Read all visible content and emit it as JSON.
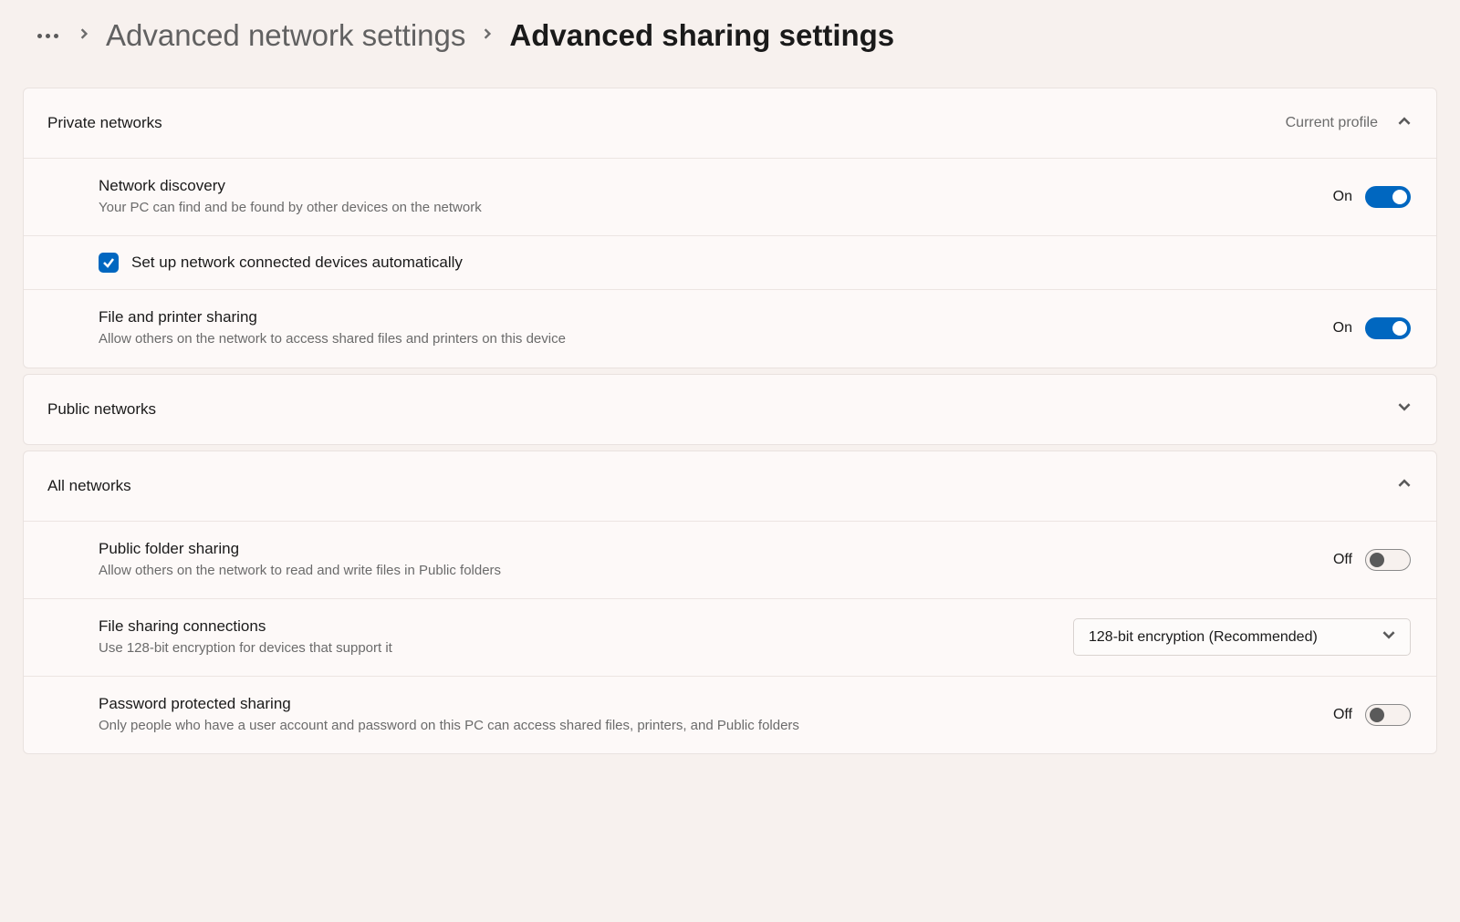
{
  "breadcrumb": {
    "parent": "Advanced network settings",
    "current": "Advanced sharing settings"
  },
  "sections": {
    "private": {
      "title": "Private networks",
      "profile_label": "Current profile",
      "expanded": true,
      "network_discovery": {
        "title": "Network discovery",
        "desc": "Your PC can find and be found by other devices on the network",
        "state_label": "On",
        "on": true
      },
      "auto_setup": {
        "label": "Set up network connected devices automatically",
        "checked": true
      },
      "file_printer_sharing": {
        "title": "File and printer sharing",
        "desc": "Allow others on the network to access shared files and printers on this device",
        "state_label": "On",
        "on": true
      }
    },
    "public": {
      "title": "Public networks",
      "expanded": false
    },
    "all": {
      "title": "All networks",
      "expanded": true,
      "public_folder_sharing": {
        "title": "Public folder sharing",
        "desc": "Allow others on the network to read and write files in Public folders",
        "state_label": "Off",
        "on": false
      },
      "file_sharing_connections": {
        "title": "File sharing connections",
        "desc": "Use 128-bit encryption for devices that support it",
        "selected": "128-bit encryption (Recommended)"
      },
      "password_protected_sharing": {
        "title": "Password protected sharing",
        "desc": "Only people who have a user account and password on this PC can access shared files, printers, and Public folders",
        "state_label": "Off",
        "on": false
      }
    }
  }
}
